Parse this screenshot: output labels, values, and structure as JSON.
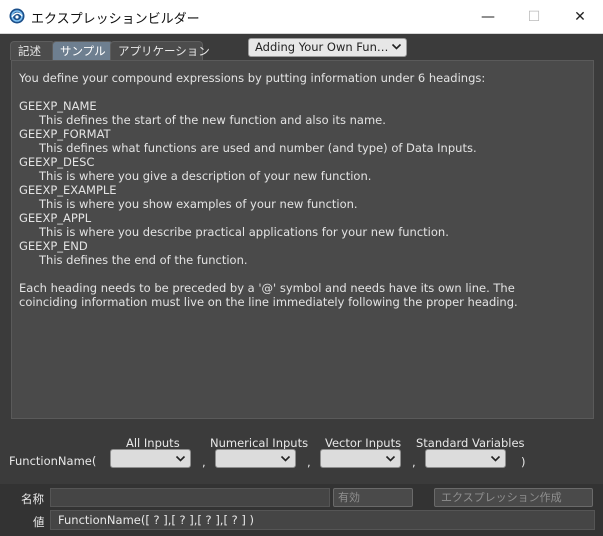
{
  "window": {
    "title": "エクスプレッションビルダー",
    "minimize_glyph": "—",
    "maximize_glyph": "☐",
    "close_glyph": "✕",
    "icon": "lightwave-icon"
  },
  "tabs": [
    {
      "label": "記述",
      "active": false
    },
    {
      "label": "サンプル",
      "active": true
    },
    {
      "label": "アプリケーション",
      "active": false
    }
  ],
  "topic_dropdown": {
    "selected": "Adding Your Own Fun…",
    "icon": "chevron-down-icon"
  },
  "description": {
    "lines": [
      "You define your compound expressions by putting information under 6 headings:",
      "GEEXP_NAME",
      "This defines the start of the new function and also its name.",
      "GEEXP_FORMAT",
      "This defines what functions are used and number (and type) of Data Inputs.",
      "GEEXP_DESC",
      "This is where you give a description of your new function.",
      "GEEXP_EXAMPLE",
      "This is where you show examples of your new function.",
      "GEEXP_APPL",
      "This is where you describe practical applications for your new function.",
      "GEEXP_END",
      "This defines the end of the function.",
      "Each heading needs to be preceded by a '@' symbol and needs have its own line. The",
      "coinciding information must live on the line immediately following the proper heading."
    ]
  },
  "inputs": {
    "function_label": "FunctionName(",
    "columns": [
      "All Inputs",
      "Numerical Inputs",
      "Vector Inputs",
      "Standard Variables"
    ],
    "separator": ",",
    "close_paren": ")"
  },
  "bottom": {
    "name_label": "名称",
    "name_value": "",
    "valid_button": "有効",
    "create_button": "エクスプレッション作成",
    "value_label": "値",
    "value_text": "FunctionName([ ? ],[ ? ],[ ? ],[ ? ] )"
  },
  "colors": {
    "background": "#3b3b3b",
    "panel": "#4a4a4a",
    "active_tab": "#6e7f90",
    "text": "#e3e3e3"
  }
}
